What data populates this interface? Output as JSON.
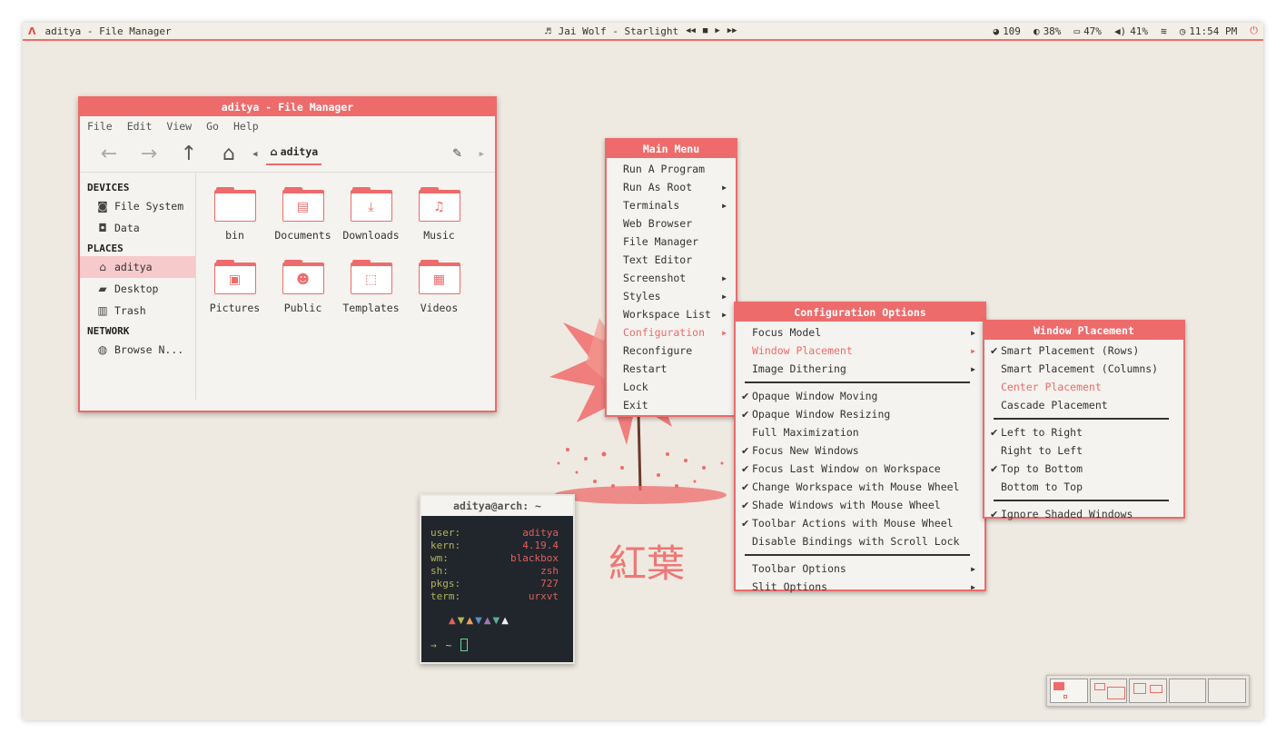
{
  "topbar": {
    "title": "aditya - File Manager",
    "now_playing": "Jai Wolf - Starlight",
    "stat_cpu": "109",
    "stat_brightness": "38%",
    "stat_battery": "47%",
    "stat_volume": "41%",
    "clock": "11:54 PM"
  },
  "filemanager": {
    "title": "aditya - File Manager",
    "menu": [
      "File",
      "Edit",
      "View",
      "Go",
      "Help"
    ],
    "breadcrumb": "aditya",
    "sidebar": {
      "devices_header": "DEVICES",
      "devices": [
        "File System",
        "Data"
      ],
      "places_header": "PLACES",
      "places": [
        "aditya",
        "Desktop",
        "Trash"
      ],
      "network_header": "NETWORK",
      "network": [
        "Browse N..."
      ]
    },
    "files": [
      "bin",
      "Documents",
      "Downloads",
      "Music",
      "Pictures",
      "Public",
      "Templates",
      "Videos"
    ]
  },
  "terminal": {
    "title": "aditya@arch: ~",
    "rows": [
      {
        "k": "user:",
        "v": "aditya"
      },
      {
        "k": "kern:",
        "v": "4.19.4"
      },
      {
        "k": "wm:",
        "v": "blackbox"
      },
      {
        "k": "sh:",
        "v": "zsh"
      },
      {
        "k": "pkgs:",
        "v": "727"
      },
      {
        "k": "term:",
        "v": "urxvt"
      }
    ],
    "prompt": "~"
  },
  "wallpaper": {
    "caption": "紅葉"
  },
  "main_menu": {
    "title": "Main Menu",
    "items": [
      "Run A Program",
      "Run As Root",
      "Terminals",
      "Web Browser",
      "File Manager",
      "Text Editor",
      "Screenshot",
      "Styles",
      "Workspace List",
      "Configuration",
      "Reconfigure",
      "Restart",
      "Lock",
      "Exit"
    ]
  },
  "config_menu": {
    "title": "Configuration Options",
    "items": [
      "Focus Model",
      "Window Placement",
      "Image Dithering",
      "Opaque Window Moving",
      "Opaque Window Resizing",
      "Full Maximization",
      "Focus New Windows",
      "Focus Last Window on Workspace",
      "Change Workspace with Mouse Wheel",
      "Shade Windows with Mouse Wheel",
      "Toolbar Actions with Mouse Wheel",
      "Disable Bindings with Scroll Lock",
      "Toolbar Options",
      "Slit Options"
    ]
  },
  "placement_menu": {
    "title": "Window Placement",
    "items": [
      "Smart Placement (Rows)",
      "Smart Placement (Columns)",
      "Center Placement",
      "Cascade Placement",
      "Left to Right",
      "Right to Left",
      "Top to Bottom",
      "Bottom to Top",
      "Ignore Shaded Windows"
    ]
  },
  "colors": {
    "accent": "#ee6b6b",
    "desktop": "#eeeae1",
    "terminal_bg": "#20262b"
  }
}
